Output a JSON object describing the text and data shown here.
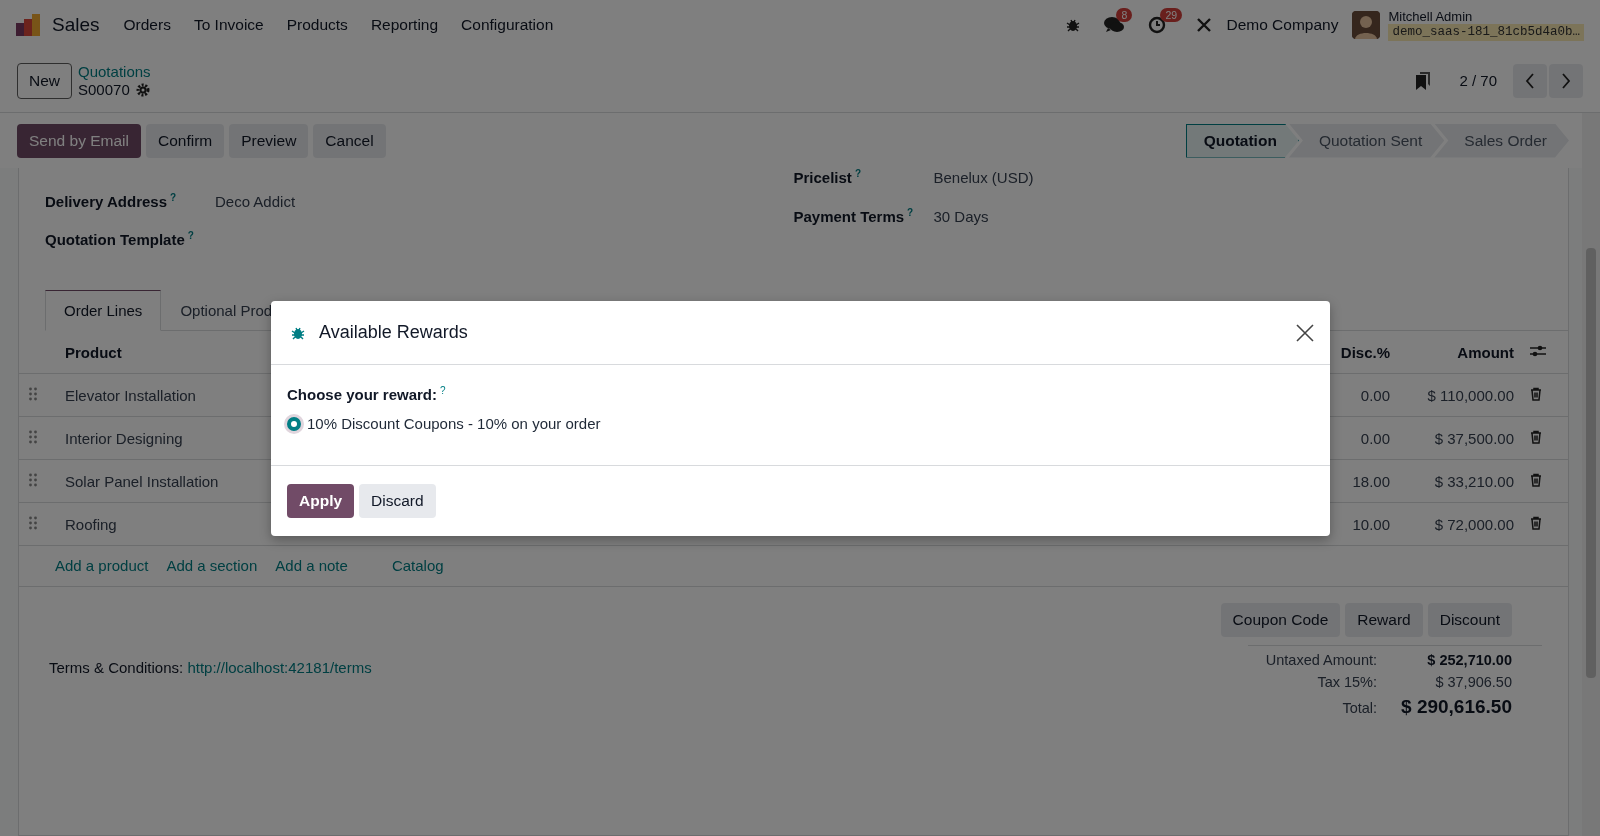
{
  "navbar": {
    "app": "Sales",
    "menu": [
      "Orders",
      "To Invoice",
      "Products",
      "Reporting",
      "Configuration"
    ],
    "messages_count": "8",
    "activities_count": "29",
    "company": "Demo Company",
    "user": "Mitchell Admin",
    "database": "demo_saas-181_81cb5d4a0b…"
  },
  "control_panel": {
    "new_button": "New",
    "breadcrumb": "Quotations",
    "record": "S00070",
    "pager": "2 / 70"
  },
  "actions": [
    {
      "label": "Send by Email",
      "kind": "primary"
    },
    {
      "label": "Confirm",
      "kind": "secondary"
    },
    {
      "label": "Preview",
      "kind": "secondary"
    },
    {
      "label": "Cancel",
      "kind": "secondary"
    }
  ],
  "stages": [
    {
      "label": "Quotation",
      "selected": true
    },
    {
      "label": "Quotation Sent",
      "selected": false
    },
    {
      "label": "Sales Order",
      "selected": false
    }
  ],
  "left_fields": [
    {
      "label": "Delivery Address",
      "help": "?",
      "value": "Deco Addict"
    },
    {
      "label": "Quotation Template",
      "help": "?"
    }
  ],
  "right_fields": [
    {
      "label": "Pricelist",
      "help": "?",
      "value": "Benelux (USD)"
    },
    {
      "label": "Payment Terms",
      "help": "?",
      "value": "30 Days"
    }
  ],
  "tabs": [
    {
      "label": "Order Lines",
      "selected": true
    },
    {
      "label": "Optional Prod",
      "selected": false
    }
  ],
  "table": {
    "columns": [
      "Product",
      "Disc.%",
      "Amount"
    ],
    "rows": [
      {
        "product": "Elevator Installation",
        "discount": "0.00",
        "amount": "$ 110,000.00"
      },
      {
        "product": "Interior Designing",
        "discount": "0.00",
        "amount": "$ 37,500.00"
      },
      {
        "product": "Solar Panel Installation",
        "discount": "18.00",
        "amount": "$ 33,210.00"
      },
      {
        "product": "Roofing",
        "discount": "10.00",
        "amount": "$ 72,000.00"
      }
    ],
    "add_links": [
      "Add a product",
      "Add a section",
      "Add a note",
      "Catalog"
    ]
  },
  "reward_buttons": [
    "Coupon Code",
    "Reward",
    "Discount"
  ],
  "terms": {
    "label": "Terms & Conditions:",
    "link": "http://localhost:42181/terms"
  },
  "totals": [
    {
      "label": "Untaxed Amount:",
      "value": "$ 252,710.00",
      "kind": "bold"
    },
    {
      "label": "Tax 15%:",
      "value": "$ 37,906.50",
      "kind": "normal"
    },
    {
      "label": "Total:",
      "value": "$ 290,616.50",
      "kind": "grand"
    }
  ],
  "modal": {
    "title": "Available Rewards",
    "prompt": "Choose your reward:",
    "prompt_help": "?",
    "options": [
      {
        "label": "10% Discount Coupons - 10% on your order",
        "selected": true
      }
    ],
    "buttons": [
      {
        "label": "Apply",
        "kind": "primary"
      },
      {
        "label": "Discard",
        "kind": "secondary"
      }
    ]
  }
}
